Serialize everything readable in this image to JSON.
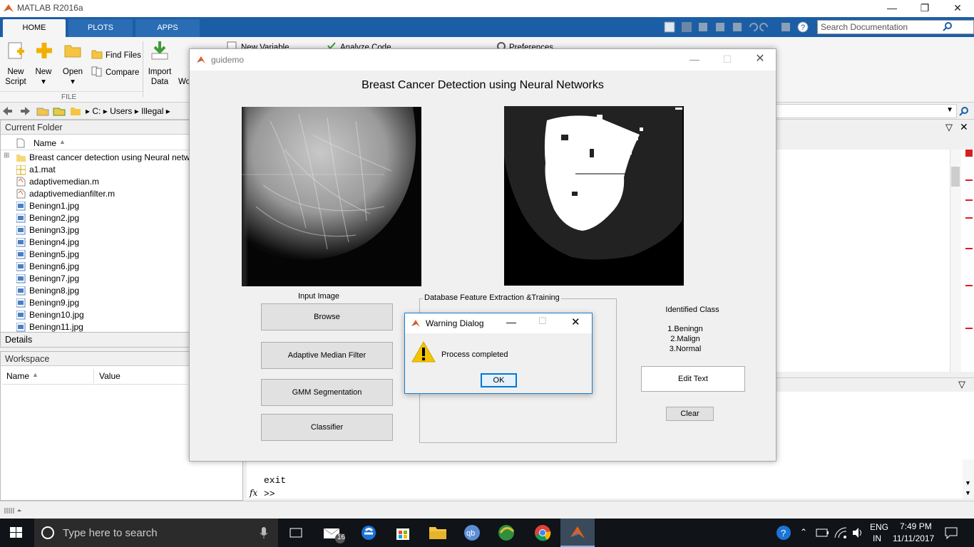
{
  "matlab": {
    "title": "MATLAB R2016a",
    "tabs": [
      "HOME",
      "PLOTS",
      "APPS"
    ],
    "search_placeholder": "Search Documentation",
    "ribbon": {
      "new_script": "New\nScript",
      "new": "New",
      "open": "Open",
      "find_files": "Find Files",
      "compare": "Compare",
      "import_data": "Import\nData",
      "wo": "Wo",
      "new_variable": "New Variable",
      "analyze_code": "Analyze Code",
      "preferences": "Preferences",
      "file_section": "FILE"
    },
    "path": [
      "C:",
      "Users",
      "Illegal"
    ],
    "current_folder": {
      "header": "Current Folder",
      "col_name": "Name",
      "files": [
        {
          "name": "Breast cancer detection using Neural netwo",
          "type": "folder"
        },
        {
          "name": "a1.mat",
          "type": "mat"
        },
        {
          "name": "adaptivemedian.m",
          "type": "m"
        },
        {
          "name": "adaptivemedianfilter.m",
          "type": "m"
        },
        {
          "name": "Beningn1.jpg",
          "type": "jpg"
        },
        {
          "name": "Beningn2.jpg",
          "type": "jpg"
        },
        {
          "name": "Beningn3.jpg",
          "type": "jpg"
        },
        {
          "name": "Beningn4.jpg",
          "type": "jpg"
        },
        {
          "name": "Beningn5.jpg",
          "type": "jpg"
        },
        {
          "name": "Beningn6.jpg",
          "type": "jpg"
        },
        {
          "name": "Beningn7.jpg",
          "type": "jpg"
        },
        {
          "name": "Beningn8.jpg",
          "type": "jpg"
        },
        {
          "name": "Beningn9.jpg",
          "type": "jpg"
        },
        {
          "name": "Beningn10.jpg",
          "type": "jpg"
        },
        {
          "name": "Beningn11.jpg",
          "type": "jpg"
        }
      ]
    },
    "details": "Details",
    "workspace": {
      "header": "Workspace",
      "col_name": "Name",
      "col_value": "Value"
    },
    "command": {
      "last": "exit",
      "prompt": ">>",
      "fx": "fx"
    }
  },
  "gui": {
    "title": "guidemo",
    "heading": "Breast Cancer Detection using Neural Networks",
    "input_image_label": "Input Image",
    "buttons": {
      "browse": "Browse",
      "adaptive": "Adaptive Median Filter",
      "gmm": "GMM Segmentation",
      "classifier": "Classifier",
      "edit_text": "Edit Text",
      "clear": "Clear"
    },
    "db_panel_title": "Database Feature Extraction &Training",
    "identified_class": "Identified Class",
    "classes": [
      "1.Beningn",
      "2.Malign",
      "3.Normal"
    ]
  },
  "dialog": {
    "title": "Warning Dialog",
    "message": "Process completed",
    "ok": "OK"
  },
  "taskbar": {
    "search": "Type here to search",
    "mail_badge": "16",
    "lang": "ENG",
    "region": "IN",
    "time": "7:49 PM",
    "date": "11/11/2017"
  },
  "colors": {
    "matlab_blue": "#1c5ea5",
    "taskbar": "#101318",
    "warning": "#f5c400",
    "error_marks": "#d62020"
  }
}
